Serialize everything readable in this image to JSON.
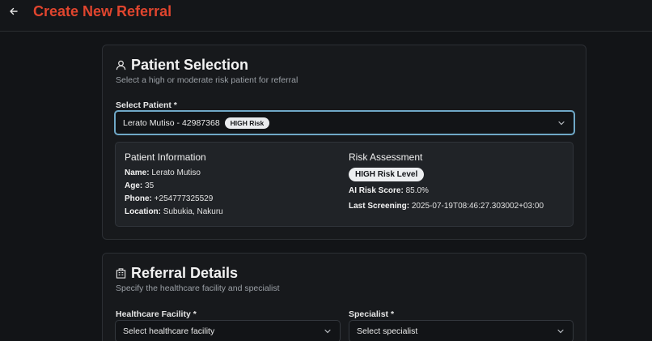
{
  "header": {
    "title": "Create New Referral"
  },
  "patient_selection": {
    "title": "Patient Selection",
    "subtitle": "Select a high or moderate risk patient for referral",
    "select_label": "Select Patient *",
    "selected_value": "Lerato Mutiso - 42987368",
    "selected_badge": "HIGH Risk",
    "info": {
      "heading": "Patient Information",
      "name_label": "Name:",
      "name": "Lerato Mutiso",
      "age_label": "Age:",
      "age": "35",
      "phone_label": "Phone:",
      "phone": "+254777325529",
      "location_label": "Location:",
      "location": "Subukia, Nakuru"
    },
    "risk": {
      "heading": "Risk Assessment",
      "level": "HIGH Risk Level",
      "score_label": "AI Risk Score:",
      "score": "85.0%",
      "screening_label": "Last Screening:",
      "screening": "2025-07-19T08:46:27.303002+03:00"
    }
  },
  "referral_details": {
    "title": "Referral Details",
    "subtitle": "Specify the healthcare facility and specialist",
    "facility_label": "Healthcare Facility *",
    "facility_placeholder": "Select healthcare facility",
    "specialist_label": "Specialist *",
    "specialist_placeholder": "Select specialist"
  },
  "colors": {
    "accent": "#e0452e",
    "focus_ring": "#6fa8c7"
  }
}
